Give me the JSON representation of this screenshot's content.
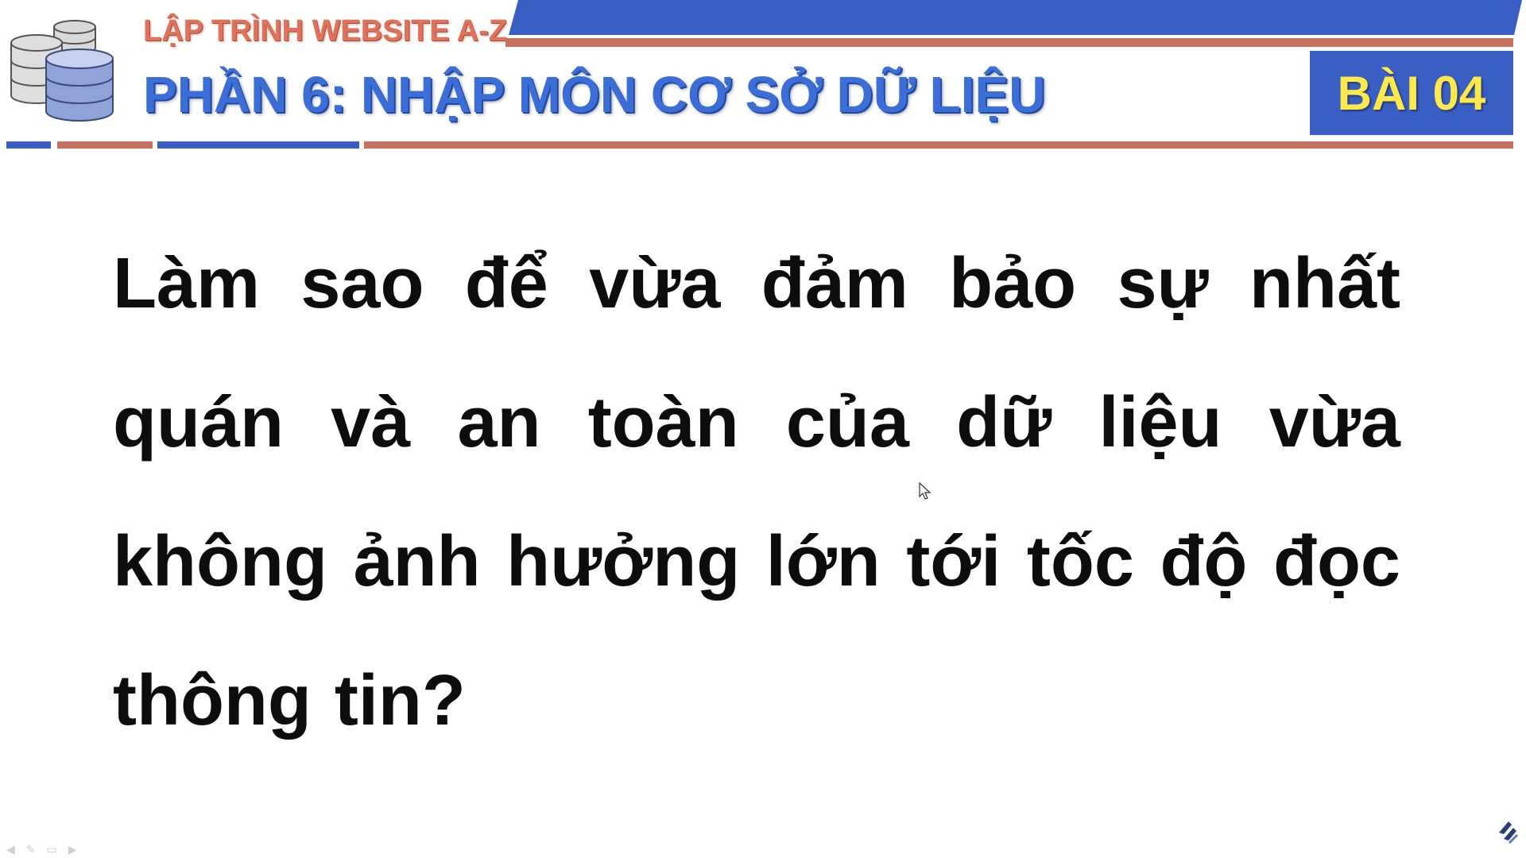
{
  "header": {
    "subtitle": "LẬP TRÌNH WEBSITE A-Z",
    "title": "PHẦN 6: NHẬP MÔN CƠ SỞ DỮ LIỆU",
    "lesson": "BÀI 04"
  },
  "body": {
    "question": "Làm sao để vừa đảm bảo sự nhất quán và an toàn của dữ liệu vừa không ảnh hưởng lớn tới tốc độ đọc thông tin?"
  },
  "colors": {
    "accent_blue": "#3a5fc4",
    "accent_red": "#c9705e",
    "title_blue": "#3b6ed6",
    "subtitle_orange": "#e0725a",
    "lesson_yellow": "#ffe94a",
    "text": "#0d0d0d"
  },
  "icons": {
    "header": "database-stack-icon",
    "cursor": "mouse-pointer-icon",
    "prev": "arrow-left-icon",
    "pen": "pen-icon",
    "menu": "menu-icon",
    "next": "arrow-right-icon",
    "logo": "brand-logo-icon"
  }
}
